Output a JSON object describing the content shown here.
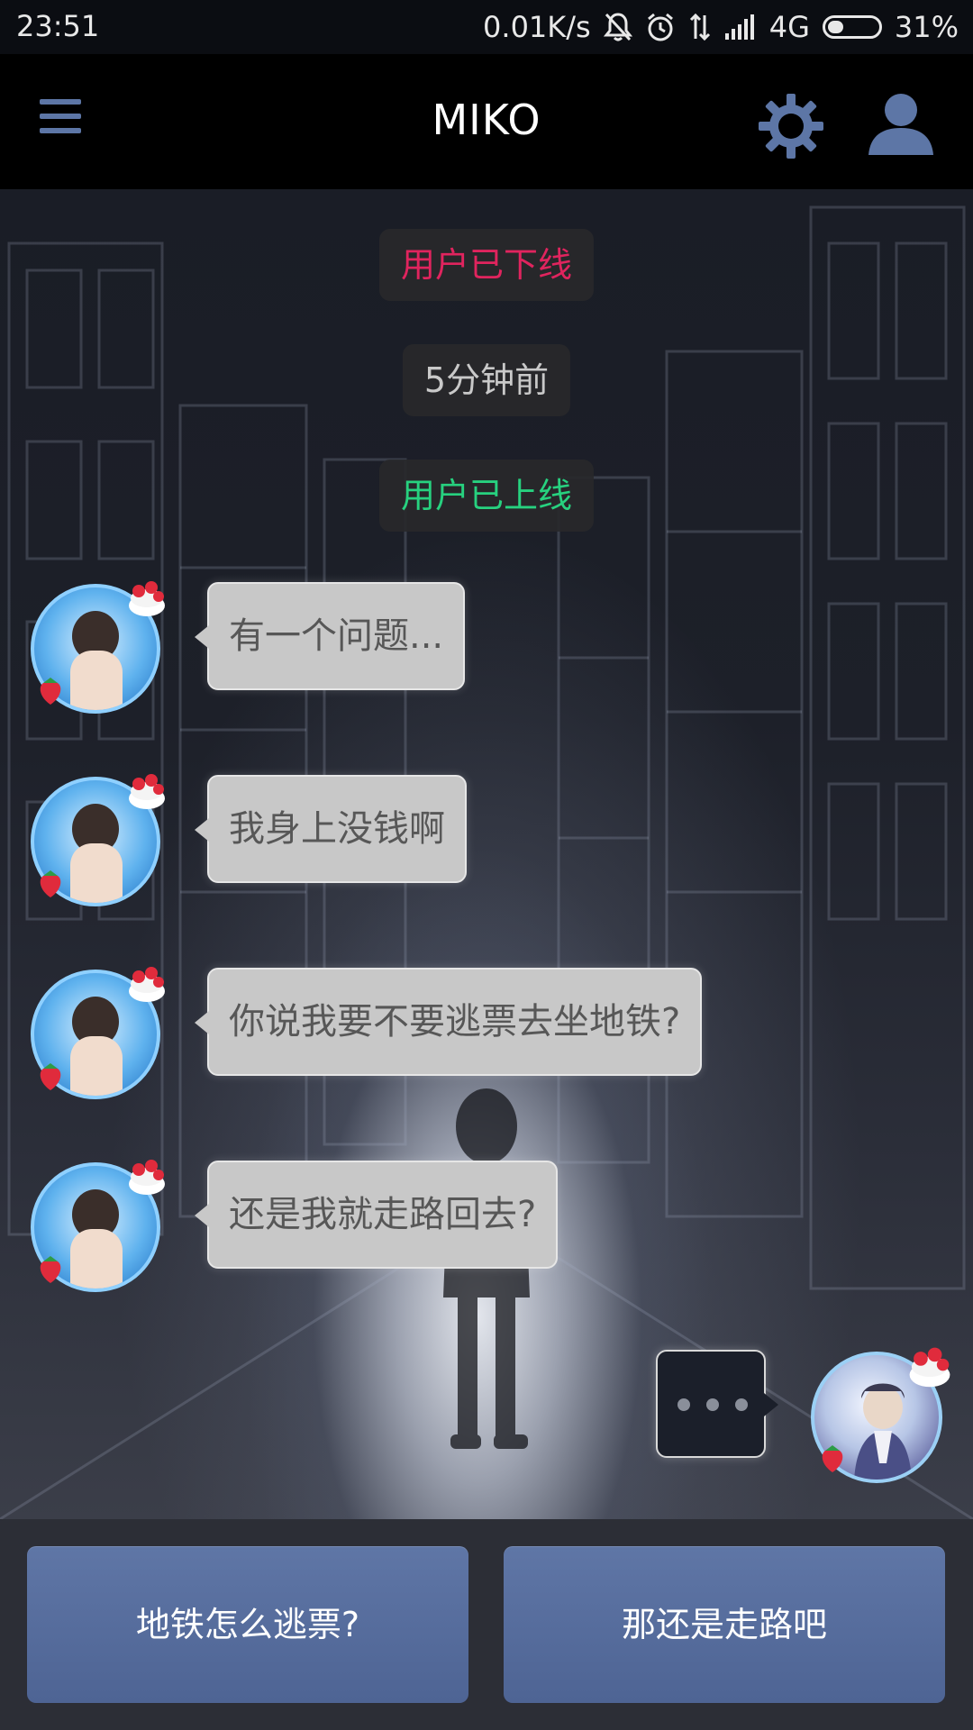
{
  "status_bar": {
    "time": "23:51",
    "net_speed": "0.01K/s",
    "network": "4G",
    "battery": "31%",
    "battery_level": 0.31,
    "icons": [
      "mute-icon",
      "alarm-icon",
      "data-transfer-icon",
      "signal-icon",
      "battery-icon"
    ]
  },
  "header": {
    "title": "MIKO",
    "icons": [
      "menu-icon",
      "gear-icon",
      "user-icon"
    ]
  },
  "colors": {
    "offline": "#e0245e",
    "online": "#27d17f",
    "time_text": "#c9c9c9",
    "accent": "#5d76a6"
  },
  "chat": {
    "system_messages": [
      {
        "text": "用户已下线",
        "color": "#e0245e"
      },
      {
        "text": "5分钟前",
        "color": "#c9c9c9"
      },
      {
        "text": "用户已上线",
        "color": "#27d17f"
      }
    ],
    "messages": [
      {
        "text": "有一个问题..."
      },
      {
        "text": "我身上没钱啊"
      },
      {
        "text": "你说我要不要逃票去坐地铁?"
      },
      {
        "text": "还是我就走路回去?"
      }
    ]
  },
  "choices": [
    {
      "label": "地铁怎么逃票?"
    },
    {
      "label": "那还是走路吧"
    }
  ]
}
